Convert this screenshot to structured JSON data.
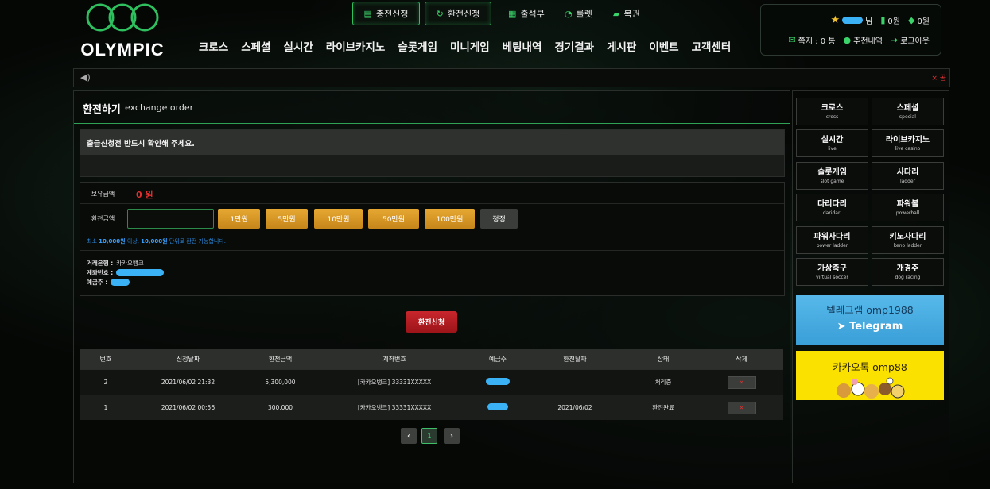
{
  "brand": {
    "logo_text": "OLYMPIC"
  },
  "top_buttons": {
    "charge": "충전신청",
    "exchange": "환전신청"
  },
  "top_links": {
    "attendance": "출석부",
    "roulette": "룰렛",
    "lottery": "복권"
  },
  "nav": [
    {
      "label": "크로스"
    },
    {
      "label": "스페셜"
    },
    {
      "label": "실시간"
    },
    {
      "label": "라이브카지노"
    },
    {
      "label": "슬롯게임"
    },
    {
      "label": "미니게임"
    },
    {
      "label": "베팅내역"
    },
    {
      "label": "경기결과"
    },
    {
      "label": "게시판"
    },
    {
      "label": "이벤트"
    },
    {
      "label": "고객센터"
    }
  ],
  "user": {
    "name_suffix": "님",
    "money": "0원",
    "point": "0원",
    "note_label": "쪽지 : 0 통",
    "recommend_label": "추천내역",
    "logout_label": "로그아웃"
  },
  "notice_bar": {
    "close_text": "× 공"
  },
  "page": {
    "title": "환전하기",
    "subtitle": "exchange order",
    "notice_header": "출금신청전 반드시 확인해 주세요."
  },
  "form": {
    "balance_label": "보유금액",
    "balance_value": "0 원",
    "amount_label": "환전금액",
    "amount_value": "",
    "amount_buttons": [
      "1만원",
      "5만원",
      "10만원",
      "50만원",
      "100만원"
    ],
    "reset_label": "정정",
    "min_note_prefix": "최소",
    "min_note_amount": "10,000원",
    "min_note_mid": "이상,",
    "min_note_unit": "10,000원",
    "min_note_suffix": "단위로 환전 가능합니다.",
    "bank_label": "거래은행 :",
    "bank_value": "카카오뱅크",
    "account_label": "계좌번호 :",
    "holder_label": "예금주 :",
    "submit_label": "환전신청"
  },
  "table": {
    "headers": [
      "번호",
      "신청날짜",
      "환전금액",
      "계좌번호",
      "예금주",
      "환전날짜",
      "상태",
      "삭제"
    ],
    "rows": [
      {
        "no": "2",
        "req_date": "2021/06/02 21:32",
        "amount": "5,300,000",
        "account": "[카카오뱅크] 33331XXXXX",
        "done_date": "",
        "status": "처리중",
        "delete": "×"
      },
      {
        "no": "1",
        "req_date": "2021/06/02 00:56",
        "amount": "300,000",
        "account": "[카카오뱅크] 33331XXXXX",
        "done_date": "2021/06/02",
        "status": "환전완료",
        "delete": "×"
      }
    ]
  },
  "pagination": {
    "prev": "‹",
    "current": "1",
    "next": "›"
  },
  "sidebar": {
    "games": [
      {
        "ko": "크로스",
        "en": "cross"
      },
      {
        "ko": "스페셜",
        "en": "special"
      },
      {
        "ko": "실시간",
        "en": "live"
      },
      {
        "ko": "라이브카지노",
        "en": "live casino"
      },
      {
        "ko": "슬롯게임",
        "en": "slot game"
      },
      {
        "ko": "사다리",
        "en": "ladder"
      },
      {
        "ko": "다리다리",
        "en": "daridari"
      },
      {
        "ko": "파워볼",
        "en": "powerball"
      },
      {
        "ko": "파워사다리",
        "en": "power ladder"
      },
      {
        "ko": "키노사다리",
        "en": "keno ladder"
      },
      {
        "ko": "가상축구",
        "en": "virtual soccer"
      },
      {
        "ko": "개경주",
        "en": "dog racing"
      }
    ],
    "telegram_id": "텔레그램 omp1988",
    "telegram_label": "Telegram",
    "kakao_id": "카카오톡 omp88"
  },
  "colors": {
    "accent_green": "#2fbf5f",
    "danger_red": "#c8262c",
    "gold": "#e6a832"
  },
  "icons": [
    "charge-icon",
    "exchange-icon",
    "calendar-icon",
    "roulette-icon",
    "lottery-icon",
    "star-icon",
    "money-icon",
    "gem-icon",
    "mail-icon",
    "users-icon",
    "logout-icon",
    "speaker-icon",
    "telegram-icon"
  ]
}
